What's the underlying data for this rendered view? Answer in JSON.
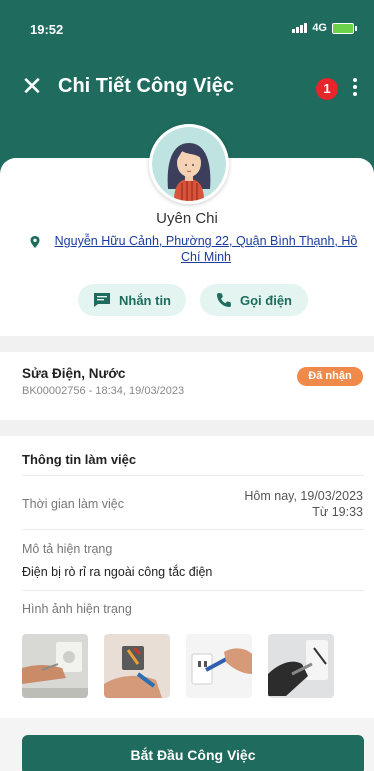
{
  "status_bar": {
    "time": "19:52",
    "network": "4G"
  },
  "header": {
    "title": "Chi Tiết Công Việc",
    "notification_count": "1"
  },
  "customer": {
    "name": "Uyên Chi",
    "address": "Nguyễn Hữu Cảnh, Phường 22, Quận Bình Thạnh, Hồ Chí Minh"
  },
  "actions": {
    "message_label": "Nhắn tin",
    "call_label": "Gọi điện"
  },
  "job": {
    "title": "Sửa Điện, Nước",
    "code_time": "BK00002756 - 18:34, 19/03/2023",
    "status": "Đã nhận"
  },
  "work_info": {
    "section_title": "Thông tin làm việc",
    "time_label": "Thời gian làm việc",
    "time_value_line1": "Hôm nay, 19/03/2023",
    "time_value_line2": "Từ 19:33",
    "desc_label": "Mô tả hiện trạng",
    "desc_value": "Điện bị rò rỉ ra ngoài công tắc điện",
    "images_label": "Hình ảnh hiện trạng"
  },
  "footer": {
    "start_button": "Bắt Đầu Công Việc"
  },
  "colors": {
    "primary": "#1f6b5e",
    "badge": "#e8252b",
    "status": "#f08a4b",
    "pill_bg": "#e3f4f1"
  }
}
